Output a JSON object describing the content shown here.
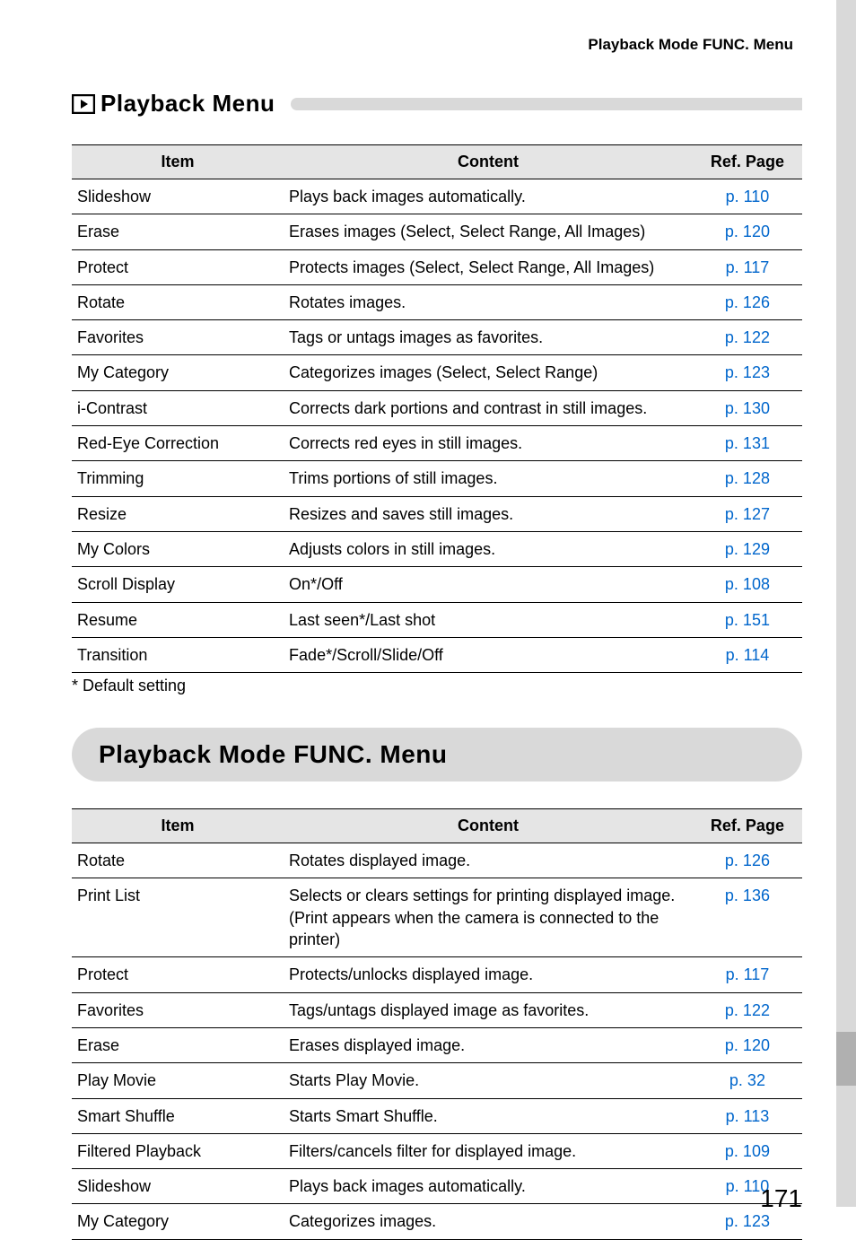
{
  "header_label": "Playback Mode FUNC. Menu",
  "section1": {
    "title": "Playback Menu"
  },
  "section2": {
    "title": "Playback Mode FUNC. Menu"
  },
  "columns": {
    "item": "Item",
    "content": "Content",
    "ref": "Ref. Page"
  },
  "footnote": "*  Default setting",
  "page_number": "171",
  "table1": [
    {
      "item": "Slideshow",
      "content": "Plays back images automatically.",
      "ref": "p. 110"
    },
    {
      "item": "Erase",
      "content": "Erases images (Select, Select Range, All Images)",
      "ref": "p. 120"
    },
    {
      "item": "Protect",
      "content": "Protects images (Select, Select Range, All Images)",
      "ref": "p. 117"
    },
    {
      "item": "Rotate",
      "content": "Rotates images.",
      "ref": "p. 126"
    },
    {
      "item": "Favorites",
      "content": "Tags or untags images as favorites.",
      "ref": "p. 122"
    },
    {
      "item": "My Category",
      "content": "Categorizes images (Select, Select Range)",
      "ref": "p. 123"
    },
    {
      "item": "i-Contrast",
      "content": "Corrects dark portions and contrast in still images.",
      "ref": "p. 130"
    },
    {
      "item": "Red-Eye Correction",
      "content": "Corrects red eyes in still images.",
      "ref": "p. 131"
    },
    {
      "item": "Trimming",
      "content": "Trims portions of still images.",
      "ref": "p. 128"
    },
    {
      "item": "Resize",
      "content": "Resizes and saves still images.",
      "ref": "p. 127"
    },
    {
      "item": "My Colors",
      "content": "Adjusts colors in still images.",
      "ref": "p. 129"
    },
    {
      "item": "Scroll Display",
      "content": "On*/Off",
      "ref": "p. 108"
    },
    {
      "item": "Resume",
      "content": "Last seen*/Last shot",
      "ref": "p. 151"
    },
    {
      "item": "Transition",
      "content": "Fade*/Scroll/Slide/Off",
      "ref": "p. 114"
    }
  ],
  "table2": [
    {
      "item": "Rotate",
      "content": "Rotates displayed image.",
      "ref": "p. 126"
    },
    {
      "item": "Print List",
      "content": "Selects or clears settings for printing displayed image. (Print appears when the camera is connected to the printer)",
      "ref": "p. 136"
    },
    {
      "item": "Protect",
      "content": "Protects/unlocks displayed image.",
      "ref": "p. 117"
    },
    {
      "item": "Favorites",
      "content": "Tags/untags displayed image as favorites.",
      "ref": "p. 122"
    },
    {
      "item": "Erase",
      "content": "Erases displayed image.",
      "ref": "p. 120"
    },
    {
      "item": "Play Movie",
      "content": "Starts Play Movie.",
      "ref": "p. 32"
    },
    {
      "item": "Smart Shuffle",
      "content": "Starts Smart Shuffle.",
      "ref": "p. 113"
    },
    {
      "item": "Filtered Playback",
      "content": "Filters/cancels filter for displayed image.",
      "ref": "p. 109"
    },
    {
      "item": "Slideshow",
      "content": "Plays back images automatically.",
      "ref": "p. 110"
    },
    {
      "item": "My Category",
      "content": "Categorizes images.",
      "ref": "p. 123"
    }
  ]
}
